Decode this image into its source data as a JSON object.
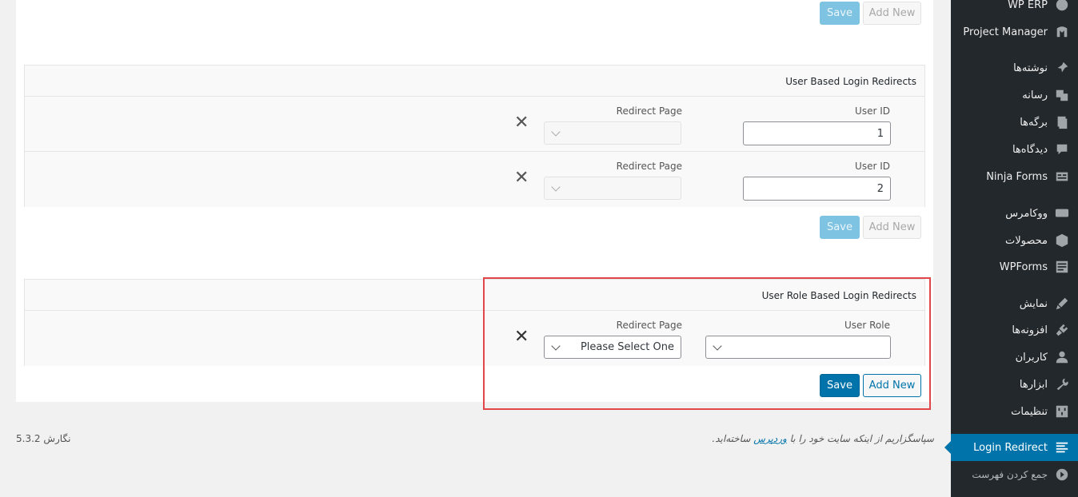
{
  "section1": {
    "save_label": "Save",
    "add_label": "Add New"
  },
  "user_box": {
    "title": "User Based Login Redirects",
    "rows": [
      {
        "id_label": "User ID",
        "id_value": "1",
        "page_label": "Redirect Page",
        "page_value": ""
      },
      {
        "id_label": "User ID",
        "id_value": "2",
        "page_label": "Redirect Page",
        "page_value": ""
      }
    ],
    "save_label": "Save",
    "add_label": "Add New"
  },
  "role_box": {
    "title": "User Role Based Login Redirects",
    "role_label": "User Role",
    "role_value": "",
    "page_label": "Redirect Page",
    "page_value": "Please Select One",
    "save_label": "Save",
    "add_label": "Add New"
  },
  "footer": {
    "version": "نگارش 5.3.2",
    "thanks_prefix": "سپاسگزاریم از اینکه سایت خود را با",
    "thanks_link": "وردپرس",
    "thanks_suffix": "ساخته‌اید."
  },
  "sidebar": {
    "items": [
      {
        "label": "WP ERP",
        "icon": "wperp-icon"
      },
      {
        "label": "Project Manager",
        "icon": "project-manager-icon"
      },
      {
        "label": "نوشته‌ها",
        "icon": "pin-icon"
      },
      {
        "label": "رسانه",
        "icon": "media-icon"
      },
      {
        "label": "برگه‌ها",
        "icon": "pages-icon"
      },
      {
        "label": "دیدگاه‌ها",
        "icon": "comments-icon"
      },
      {
        "label": "Ninja Forms",
        "icon": "ninja-forms-icon"
      },
      {
        "label": "ووکامرس",
        "icon": "woo-icon"
      },
      {
        "label": "محصولات",
        "icon": "products-icon"
      },
      {
        "label": "WPForms",
        "icon": "wpforms-icon"
      },
      {
        "label": "نمایش",
        "icon": "appearance-icon"
      },
      {
        "label": "افزونه‌ها",
        "icon": "plugins-icon"
      },
      {
        "label": "کاربران",
        "icon": "users-icon"
      },
      {
        "label": "ابزارها",
        "icon": "tools-icon"
      },
      {
        "label": "تنظیمات",
        "icon": "settings-icon"
      },
      {
        "label": "Login Redirect",
        "icon": "list-icon"
      },
      {
        "label": "جمع کردن فهرست",
        "icon": "collapse-icon"
      }
    ]
  }
}
